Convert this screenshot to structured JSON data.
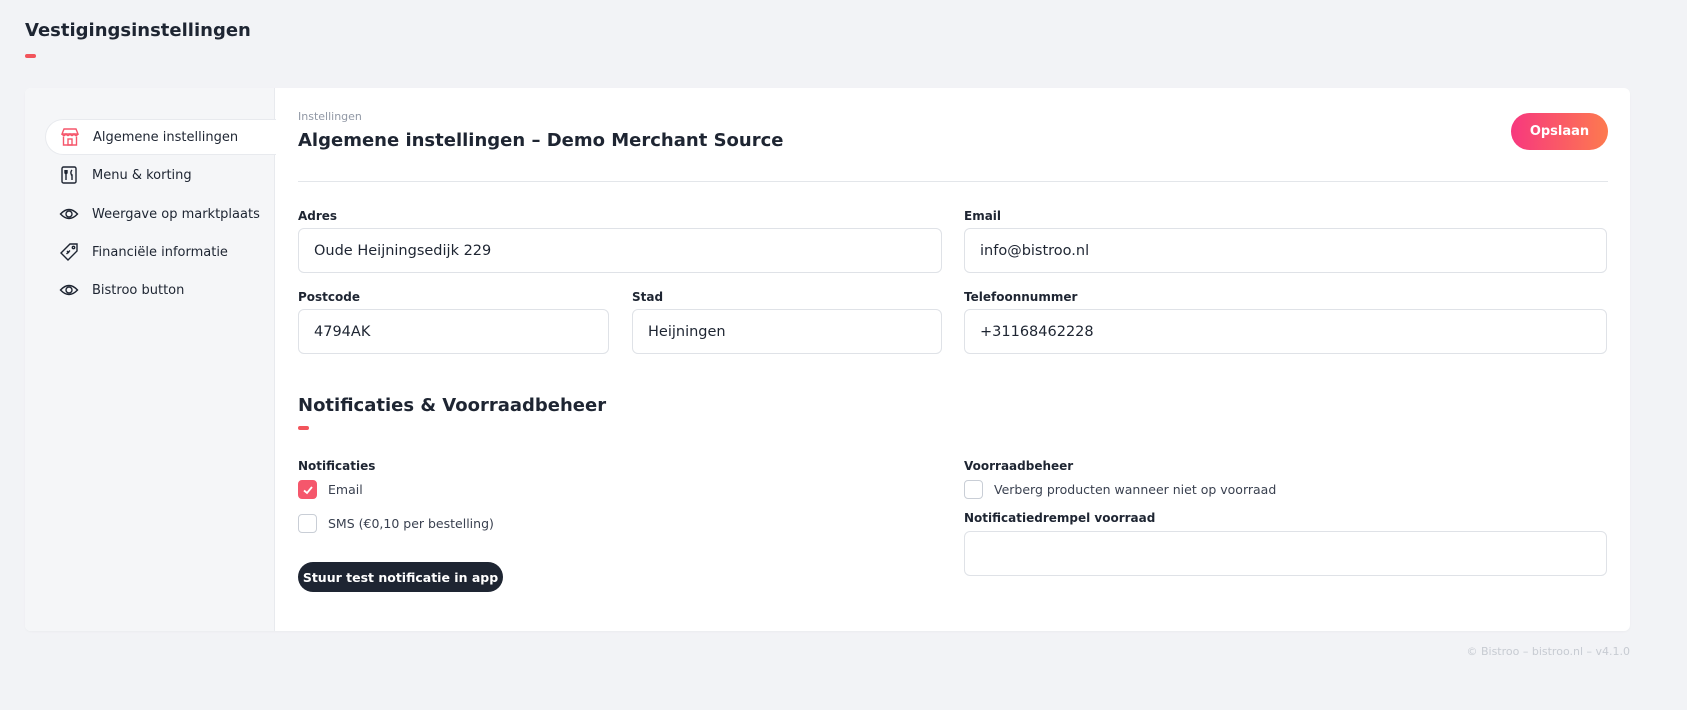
{
  "page": {
    "title": "Vestigingsinstellingen"
  },
  "sidebar": {
    "items": [
      {
        "label": "Algemene instellingen",
        "icon": "store-icon",
        "active": true
      },
      {
        "label": "Menu & korting",
        "icon": "menu-cutlery-icon",
        "active": false
      },
      {
        "label": "Weergave op marktplaats",
        "icon": "eye-icon",
        "active": false
      },
      {
        "label": "Financiële informatie",
        "icon": "price-tag-icon",
        "active": false
      },
      {
        "label": "Bistroo button",
        "icon": "eye-icon",
        "active": false
      }
    ]
  },
  "header": {
    "breadcrumb": "Instellingen",
    "title": "Algemene instellingen – Demo Merchant Source",
    "save_label": "Opslaan"
  },
  "form": {
    "address": {
      "label": "Adres",
      "value": "Oude Heijningsedijk 229"
    },
    "email": {
      "label": "Email",
      "value": "info@bistroo.nl"
    },
    "postcode": {
      "label": "Postcode",
      "value": "4794AK"
    },
    "city": {
      "label": "Stad",
      "value": "Heijningen"
    },
    "phone": {
      "label": "Telefoonnummer",
      "value": "+31168462228"
    }
  },
  "notifications_section": {
    "title": "Notificaties & Voorraadbeheer",
    "notifications_label": "Notificaties",
    "email_option": {
      "label": "Email",
      "checked": true
    },
    "sms_option": {
      "label": "SMS (€0,10 per bestelling)",
      "checked": false
    },
    "test_button_label": "Stuur test notificatie in app",
    "inventory_label": "Voorraadbeheer",
    "hide_products_option": {
      "label": "Verberg producten wanneer niet op voorraad",
      "checked": false
    },
    "threshold": {
      "label": "Notificatiedrempel voorraad",
      "value": ""
    }
  },
  "footer": {
    "text": "© Bistroo – bistroo.nl – v4.1.0"
  },
  "colors": {
    "accent": "#f2545b",
    "button_gradient_start": "#f7387e",
    "button_gradient_end": "#fd7a4f",
    "dark": "#1e2532",
    "background": "#f2f3f6"
  }
}
